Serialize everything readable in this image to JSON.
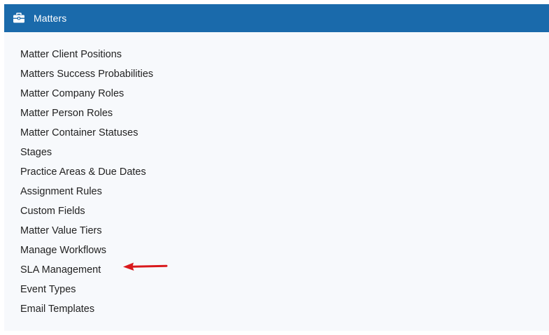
{
  "panel": {
    "title": "Matters",
    "icon": "briefcase-icon",
    "header_color": "#1a6aab"
  },
  "menu": {
    "items": [
      {
        "label": "Matter Client Positions"
      },
      {
        "label": "Matters Success Probabilities"
      },
      {
        "label": "Matter Company Roles"
      },
      {
        "label": "Matter Person Roles"
      },
      {
        "label": "Matter Container Statuses"
      },
      {
        "label": "Stages"
      },
      {
        "label": "Practice Areas & Due Dates"
      },
      {
        "label": "Assignment Rules"
      },
      {
        "label": "Custom Fields"
      },
      {
        "label": "Matter Value Tiers"
      },
      {
        "label": "Manage Workflows"
      },
      {
        "label": "SLA Management"
      },
      {
        "label": "Event Types"
      },
      {
        "label": "Email Templates"
      }
    ]
  },
  "annotation": {
    "icon": "red-arrow-icon",
    "points_to": "SLA Management",
    "color": "#d9191c"
  }
}
